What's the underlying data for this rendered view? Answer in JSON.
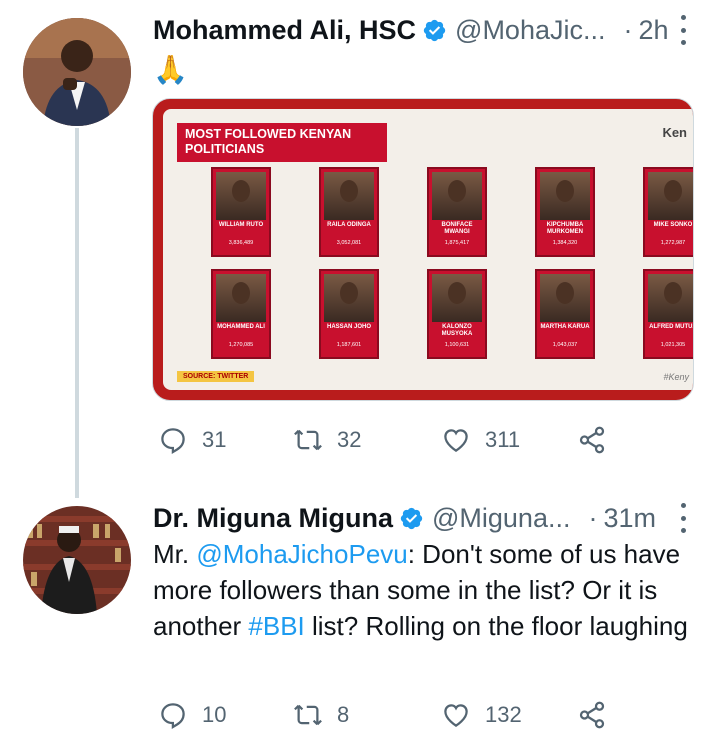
{
  "tweet1": {
    "name": "Mohammed Ali, HSC",
    "handle": "@MohaJic...",
    "separator": "·",
    "time": "2h",
    "text": "🙏",
    "media": {
      "title": "MOST FOLLOWED KENYAN POLITICIANS",
      "brand": "Ken",
      "source": "SOURCE: TWITTER",
      "tag": "#Keny",
      "people": [
        {
          "name": "WILLIAM RUTO",
          "followers": "3,836,489"
        },
        {
          "name": "RAILA ODINGA",
          "followers": "3,052,081"
        },
        {
          "name": "BONIFACE MWANGI",
          "followers": "1,875,417"
        },
        {
          "name": "KIPCHUMBA MURKOMEN",
          "followers": "1,384,320"
        },
        {
          "name": "MIKE SONKO",
          "followers": "1,272,987"
        },
        {
          "name": "MOHAMMED ALI",
          "followers": "1,270,085"
        },
        {
          "name": "HASSAN JOHO",
          "followers": "1,187,601"
        },
        {
          "name": "KALONZO MUSYOKA",
          "followers": "1,100,631"
        },
        {
          "name": "MARTHA KARUA",
          "followers": "1,043,037"
        },
        {
          "name": "ALFRED MUTUA",
          "followers": "1,021,305"
        }
      ]
    },
    "actions": {
      "replies": "31",
      "retweets": "32",
      "likes": "311"
    },
    "accent": "#1d9bf0",
    "brand_red": "#c8102e"
  },
  "tweet2": {
    "name": "Dr. Miguna Miguna",
    "handle": "@Miguna...",
    "separator": "·",
    "time": "31m",
    "text_prefix": "Mr. ",
    "mention": "@MohaJichoPevu",
    "text_mid": ": Don't some of us have more followers than some in the list? Or it is another ",
    "hashtag": "#BBI",
    "text_suffix": " list? Rolling on the floor laughing",
    "actions": {
      "replies": "10",
      "retweets": "8",
      "likes": "132"
    }
  },
  "icons": {
    "verified": "verified-badge-icon",
    "more": "more-dots-icon",
    "reply": "reply-icon",
    "retweet": "retweet-icon",
    "like": "heart-icon",
    "share": "share-icon"
  }
}
